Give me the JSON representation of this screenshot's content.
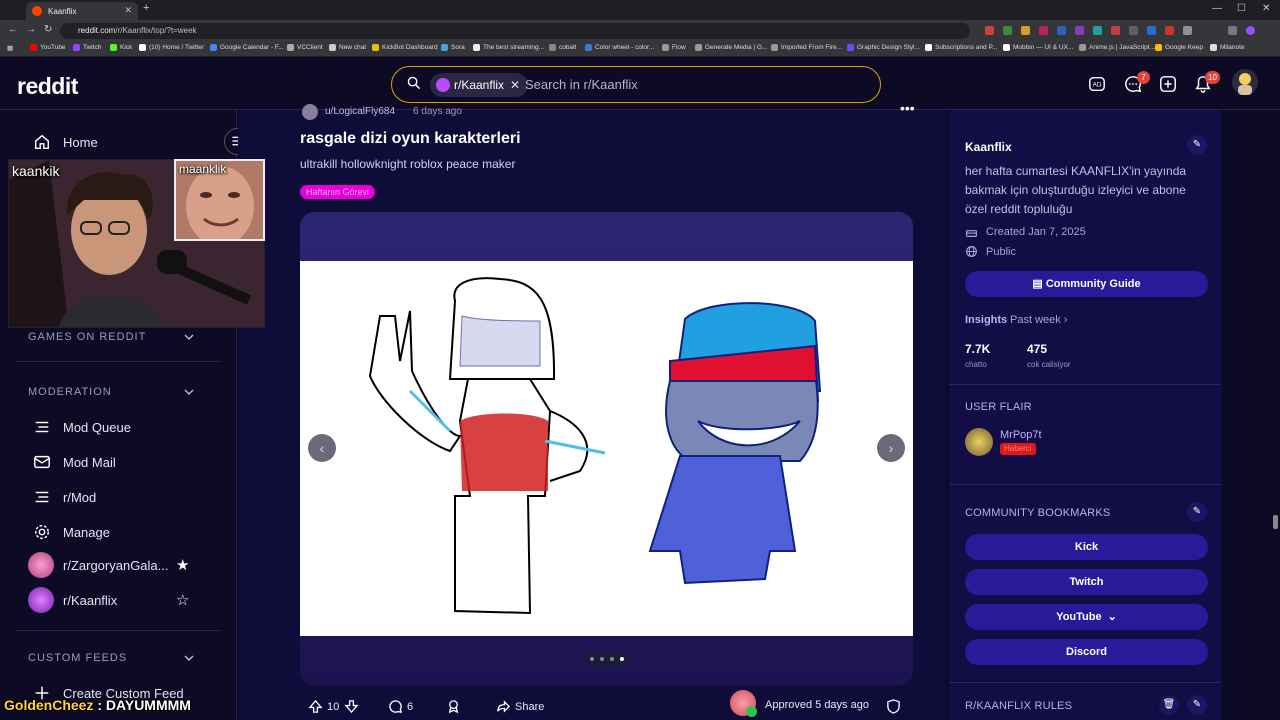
{
  "browser": {
    "tab_title": "Kaanflix",
    "url_host": "reddit.com",
    "url_path": "/r/Kaanflix/top/?t=week",
    "bookmarks": [
      "YouTube",
      "Twitch",
      "Kick",
      "(10) Home / Twitter",
      "Google Calendar - F...",
      "VCClient",
      "New chat",
      "KickBot Dashboard",
      "Sora",
      "The best streaming...",
      "cobalt",
      "Color wheel - color...",
      "Flow",
      "Generate Media | G...",
      "Imported From Fire...",
      "Graphic Design Styl...",
      "Subscriptions and P...",
      "Mobbin — UI & UX...",
      "Anime.js | JavaScript...",
      "Google Keep",
      "Milanote"
    ]
  },
  "header": {
    "logo": "reddit",
    "search_chip": "r/Kaanflix",
    "search_placeholder": "Search in r/Kaanflix",
    "chat_badge": "7",
    "notif_badge": "10"
  },
  "webcam": {
    "main_label": "kaankik",
    "secondary_label": "maanklik"
  },
  "sidebar": {
    "home": "Home",
    "games_section": "GAMES ON REDDIT",
    "moderation_section": "MODERATION",
    "mod_items": [
      "Mod Queue",
      "Mod Mail",
      "r/Mod",
      "Manage"
    ],
    "communities": [
      {
        "name": "r/ZargoryanGala..."
      },
      {
        "name": "r/Kaanflix"
      }
    ],
    "custom_feeds_section": "CUSTOM FEEDS",
    "create_feed": "Create Custom Feed"
  },
  "post": {
    "author": "u/LogicalFly684",
    "time": "6 days ago",
    "title": "rasgale dizi oyun karakterleri",
    "body": "ultrakill hollowknight roblox peace maker",
    "flair": "Haftanın Görevi",
    "votes": "10",
    "comments": "6",
    "share": "Share",
    "approved": "Approved 5 days ago",
    "gallery_total": 4,
    "gallery_active": 4
  },
  "community": {
    "name": "Kaanflix",
    "description": "her hafta cumartesi KAANFLIX'in yayında bakmak için oluşturduğu izleyici ve abone özel reddit topluluğu",
    "created": "Created Jan 7, 2025",
    "visibility": "Public",
    "guide_button": "Community Guide",
    "insights_label": "Insights",
    "insights_range": "Past week",
    "stats": [
      {
        "value": "7.7K",
        "label": "chatto"
      },
      {
        "value": "475",
        "label": "cok calisiyor"
      }
    ],
    "user_flair_head": "USER FLAIR",
    "flair_user": "MrPop7t",
    "flair_tag": "Haberci",
    "bookmarks_head": "COMMUNITY BOOKMARKS",
    "bookmark_links": [
      "Kick",
      "Twitch",
      "YouTube",
      "Discord"
    ],
    "rules_head": "R/KAANFLIX RULES"
  },
  "chat_overlay": {
    "user": "GoldenCheez",
    "sep": " : ",
    "message": "DAYUMMMM"
  },
  "colors": {
    "accent": "#2a1a9a",
    "flair": "#e600d8",
    "search_border": "#d9a400",
    "badge": "#e0443a"
  }
}
